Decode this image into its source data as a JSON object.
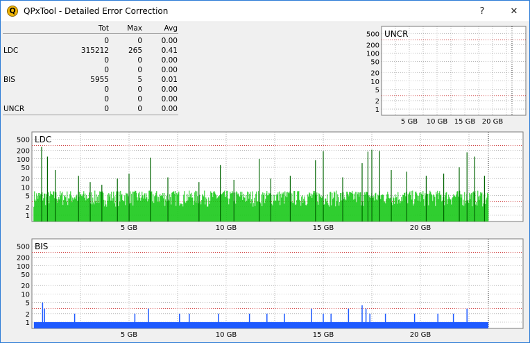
{
  "window": {
    "title": "QPxTool - Detailed Error Correction",
    "help_label": "?",
    "close_label": "✕",
    "icon": "qpxtool-app-icon",
    "icon_letter": "Q"
  },
  "stats": {
    "headers": {
      "tot": "Tot",
      "max": "Max",
      "avg": "Avg"
    },
    "rows": [
      {
        "label": "",
        "tot": "0",
        "max": "0",
        "avg": "0.00"
      },
      {
        "label": "LDC",
        "tot": "315212",
        "max": "265",
        "avg": "0.41"
      },
      {
        "label": "",
        "tot": "0",
        "max": "0",
        "avg": "0.00"
      },
      {
        "label": "",
        "tot": "0",
        "max": "0",
        "avg": "0.00"
      },
      {
        "label": "BIS",
        "tot": "5955",
        "max": "5",
        "avg": "0.01"
      },
      {
        "label": "",
        "tot": "0",
        "max": "0",
        "avg": "0.00"
      },
      {
        "label": "",
        "tot": "0",
        "max": "0",
        "avg": "0.00"
      },
      {
        "label": "UNCR",
        "tot": "0",
        "max": "0",
        "avg": "0.00"
      }
    ]
  },
  "colors": {
    "ldc_fill": "#14c814",
    "ldc_dark": "#006400",
    "bis_fill": "#1e5aff",
    "grid": "#8c8c8c",
    "threshold": "#c00000"
  },
  "chart_data": [
    {
      "id": "uncr",
      "type": "bar",
      "title": "UNCR",
      "yscale": "log",
      "yticks": [
        "500",
        "200",
        "100",
        "50",
        "20",
        "10",
        "5",
        "2",
        "1"
      ],
      "xticks": [
        "5 GB",
        "10 GB",
        "15 GB",
        "20 GB"
      ],
      "xlim": [
        0,
        24
      ],
      "series": []
    },
    {
      "id": "ldc",
      "type": "bar",
      "title": "LDC",
      "yscale": "log",
      "yticks": [
        "500",
        "200",
        "100",
        "50",
        "20",
        "10",
        "5",
        "2",
        "1"
      ],
      "xticks": [
        "5 GB",
        "10 GB",
        "15 GB",
        "20 GB"
      ],
      "xlim": [
        0,
        24
      ],
      "max": 265,
      "baseline": [
        0.1,
        23.5,
        5
      ],
      "peaks": [
        [
          0.5,
          265
        ],
        [
          0.8,
          120
        ],
        [
          1.2,
          40
        ],
        [
          2.4,
          25
        ],
        [
          3.0,
          15
        ],
        [
          3.6,
          12
        ],
        [
          4.4,
          20
        ],
        [
          5.0,
          30
        ],
        [
          6.1,
          110
        ],
        [
          7.0,
          22
        ],
        [
          8.6,
          15
        ],
        [
          9.7,
          60
        ],
        [
          10.4,
          18
        ],
        [
          11.7,
          100
        ],
        [
          12.3,
          20
        ],
        [
          13.3,
          25
        ],
        [
          14.6,
          90
        ],
        [
          15.0,
          185
        ],
        [
          16.0,
          22
        ],
        [
          17.0,
          70
        ],
        [
          17.3,
          180
        ],
        [
          17.5,
          210
        ],
        [
          17.9,
          190
        ],
        [
          18.5,
          40
        ],
        [
          19.3,
          35
        ],
        [
          20.3,
          25
        ],
        [
          21.2,
          30
        ],
        [
          22.0,
          50
        ],
        [
          22.4,
          170
        ],
        [
          22.8,
          120
        ],
        [
          23.3,
          25
        ]
      ]
    },
    {
      "id": "bis",
      "type": "bar",
      "title": "BIS",
      "yscale": "log",
      "yticks": [
        "500",
        "200",
        "100",
        "50",
        "20",
        "10",
        "5",
        "2",
        "1"
      ],
      "xticks": [
        "5 GB",
        "10 GB",
        "15 GB",
        "20 GB"
      ],
      "xlim": [
        0,
        24
      ],
      "max": 5,
      "baseline": [
        0.1,
        23.5,
        1
      ],
      "peaks": [
        [
          0.55,
          5
        ],
        [
          0.65,
          3
        ],
        [
          2.2,
          2
        ],
        [
          5.3,
          2
        ],
        [
          6.0,
          3
        ],
        [
          7.6,
          2
        ],
        [
          8.1,
          2
        ],
        [
          9.6,
          2
        ],
        [
          11.2,
          2
        ],
        [
          12.1,
          2
        ],
        [
          13.0,
          2
        ],
        [
          14.4,
          3
        ],
        [
          15.0,
          2
        ],
        [
          15.4,
          2
        ],
        [
          16.3,
          3
        ],
        [
          17.0,
          4
        ],
        [
          17.2,
          3
        ],
        [
          17.4,
          2
        ],
        [
          18.2,
          2
        ],
        [
          19.7,
          2
        ],
        [
          20.9,
          2
        ],
        [
          21.7,
          2
        ],
        [
          22.4,
          3
        ]
      ]
    }
  ]
}
